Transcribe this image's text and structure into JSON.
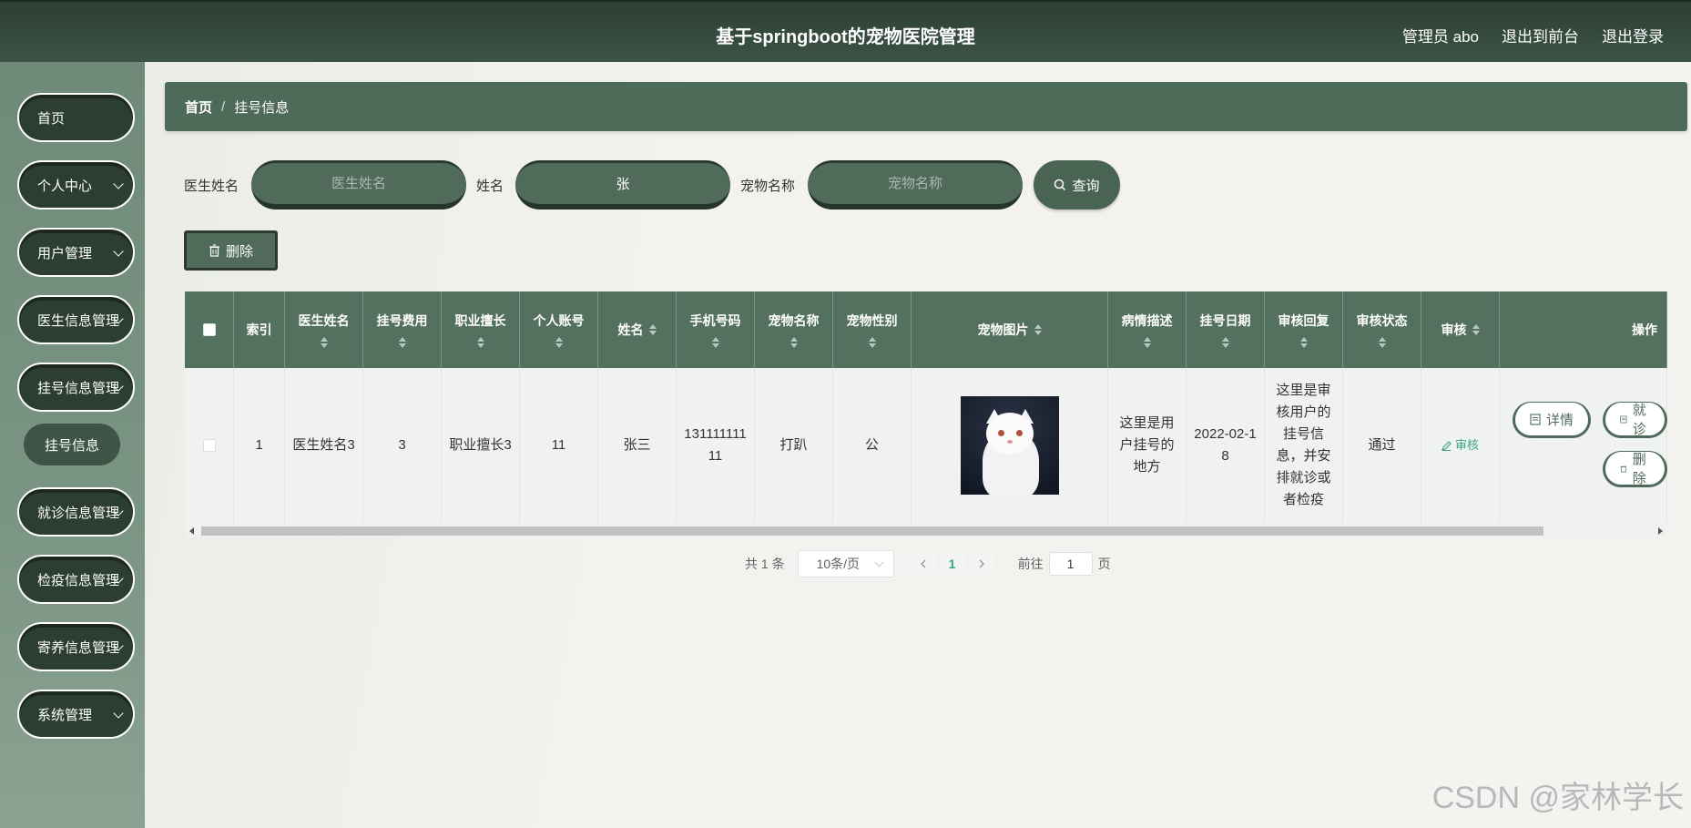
{
  "header": {
    "title": "基于springboot的宠物医院管理",
    "links": [
      "管理员 abo",
      "退出到前台",
      "退出登录"
    ]
  },
  "sidebar": {
    "items": [
      "首页",
      "个人中心",
      "用户管理",
      "医生信息管理",
      "挂号信息管理",
      "就诊信息管理",
      "检疫信息管理",
      "寄养信息管理",
      "系统管理"
    ],
    "active_sub": "挂号信息"
  },
  "breadcrumb": {
    "home": "首页",
    "current": "挂号信息"
  },
  "search": {
    "doctor_label": "医生姓名",
    "doctor_placeholder": "医生姓名",
    "doctor_value": "",
    "name_label": "姓名",
    "name_value": "张",
    "pet_label": "宠物名称",
    "pet_placeholder": "宠物名称",
    "pet_value": "",
    "query_label": "查询"
  },
  "actions": {
    "delete_label": "删除"
  },
  "table": {
    "columns": [
      "索引",
      "医生姓名",
      "挂号费用",
      "职业擅长",
      "个人账号",
      "姓名",
      "手机号码",
      "宠物名称",
      "宠物性别",
      "宠物图片",
      "病情描述",
      "挂号日期",
      "审核回复",
      "审核状态",
      "审核",
      "操作"
    ],
    "rows": [
      {
        "index": "1",
        "doctor_name": "医生姓名3",
        "fee": "3",
        "specialty": "职业擅长3",
        "account": "11",
        "name": "张三",
        "phone": "13111111111",
        "pet_name": "打趴",
        "pet_gender": "公",
        "description": "这里是用户挂号的地方",
        "date": "2022-02-18",
        "reply": "这里是审核用户的挂号信息，并安排就诊或者检疫",
        "status": "通过",
        "audit": "审核",
        "ops": [
          "详情",
          "就诊",
          "删除"
        ]
      }
    ]
  },
  "pagination": {
    "total": "共 1 条",
    "page_size": "10条/页",
    "current_page": "1",
    "goto_label": "前往",
    "goto_value": "1",
    "page_suffix": "页"
  },
  "watermark": "CSDN @家林学长",
  "colors": {
    "primary": "#54705f",
    "dark": "#2c3d32",
    "accent": "#3aa57c"
  }
}
